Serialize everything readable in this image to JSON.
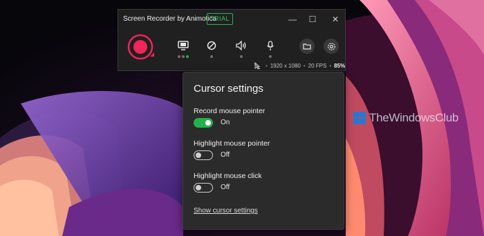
{
  "recorder": {
    "title": "Screen Recorder by Animotica",
    "badge": "TRIAL",
    "window_controls": {
      "minimize": "—",
      "maximize": "☐",
      "close": "✕"
    },
    "tools": [
      {
        "name": "display",
        "icon": "monitor-icon"
      },
      {
        "name": "webcam",
        "icon": "webcam-icon"
      },
      {
        "name": "system-audio",
        "icon": "speaker-icon"
      },
      {
        "name": "microphone",
        "icon": "microphone-icon"
      }
    ],
    "status": {
      "resolution": "1920 x 1080",
      "fps": "20 FPS",
      "scale": "85%"
    },
    "colors": {
      "record": "#f0255a",
      "active_dot": "#22b24c",
      "trial": "#31c964"
    }
  },
  "cursor_settings": {
    "title": "Cursor settings",
    "options": [
      {
        "label": "Record mouse pointer",
        "state": "On",
        "enabled": true
      },
      {
        "label": "Highlight mouse pointer",
        "state": "Off",
        "enabled": false
      },
      {
        "label": "Highlight mouse click",
        "state": "Off",
        "enabled": false
      }
    ],
    "link": "Show cursor settings"
  },
  "watermark": {
    "text": "TheWindowsClub"
  }
}
